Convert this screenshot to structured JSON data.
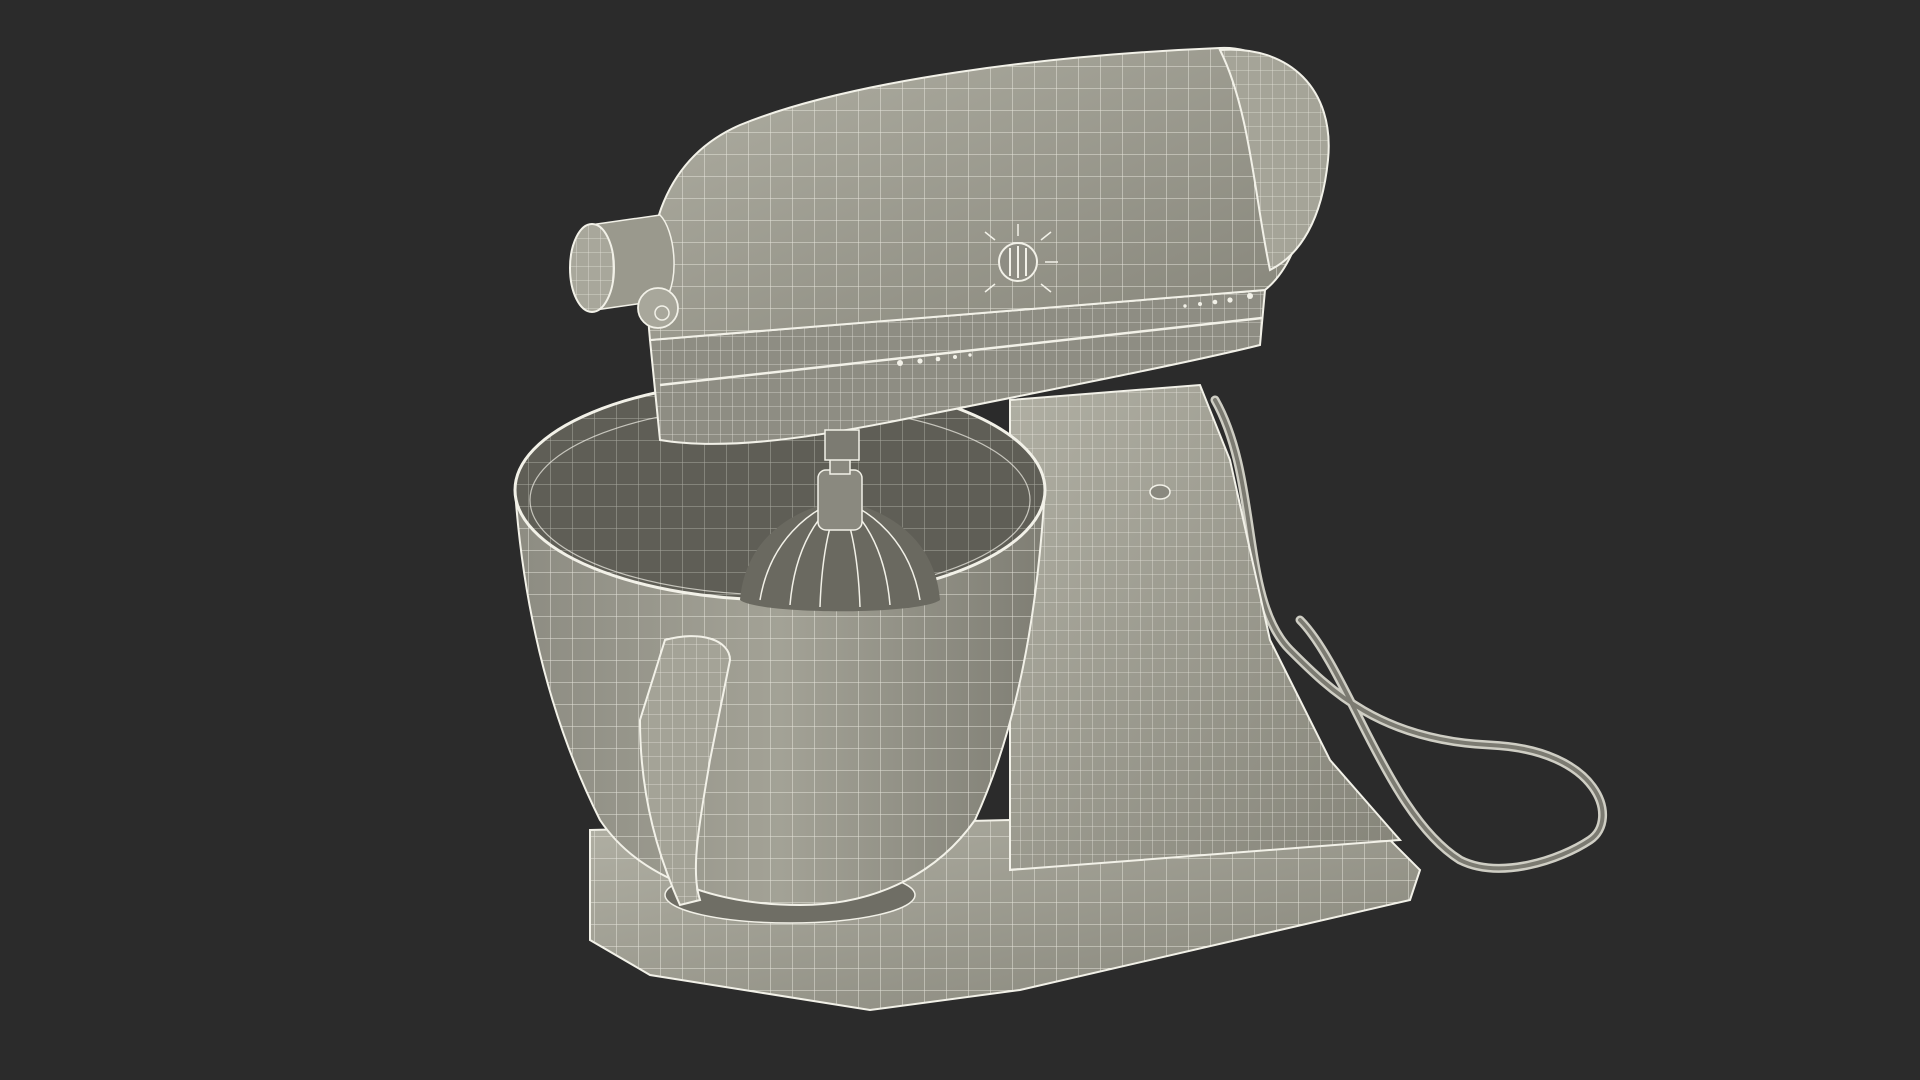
{
  "scene": {
    "subject": "stand-mixer",
    "render_style": "wireframe",
    "colors": {
      "background": "#2b2b2b",
      "surface": "#9e9d92",
      "surface_dark": "#7c7b72",
      "surface_light": "#b8b7ab",
      "wire": "#f2f1e8"
    }
  }
}
